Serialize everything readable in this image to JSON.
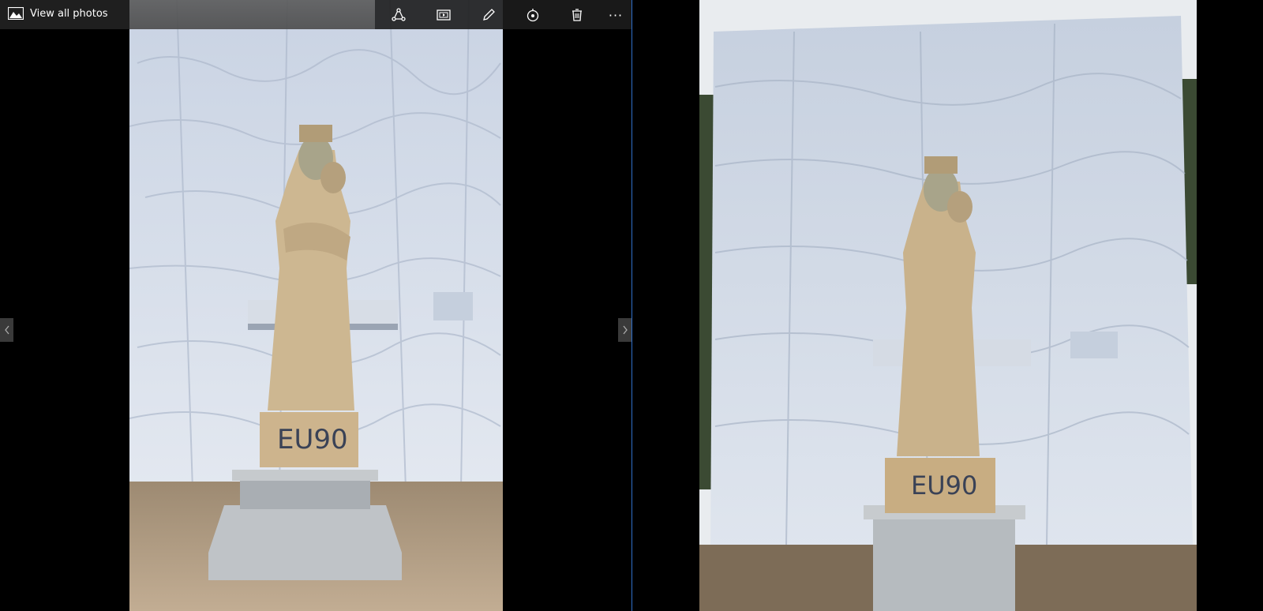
{
  "app": {
    "title": "View all photos",
    "icon": "photos-icon"
  },
  "toolbar": {
    "buttons": [
      {
        "name": "share",
        "icon": "share-icon"
      },
      {
        "name": "slideshow",
        "icon": "slideshow-icon"
      },
      {
        "name": "edit",
        "icon": "pen-icon"
      },
      {
        "name": "rotate",
        "icon": "rotate-icon"
      },
      {
        "name": "delete",
        "icon": "trash-icon"
      },
      {
        "name": "more",
        "label": "···",
        "icon": "more-icon"
      }
    ]
  },
  "navigation": {
    "prev_icon": "chevron-left-icon",
    "next_icon": "chevron-right-icon"
  },
  "photos": [
    {
      "description": ""
    },
    {
      "description": ""
    }
  ],
  "colors": {
    "toolbar_bg": "#1f1f1f",
    "accent_divider": "#2f6fc9"
  }
}
